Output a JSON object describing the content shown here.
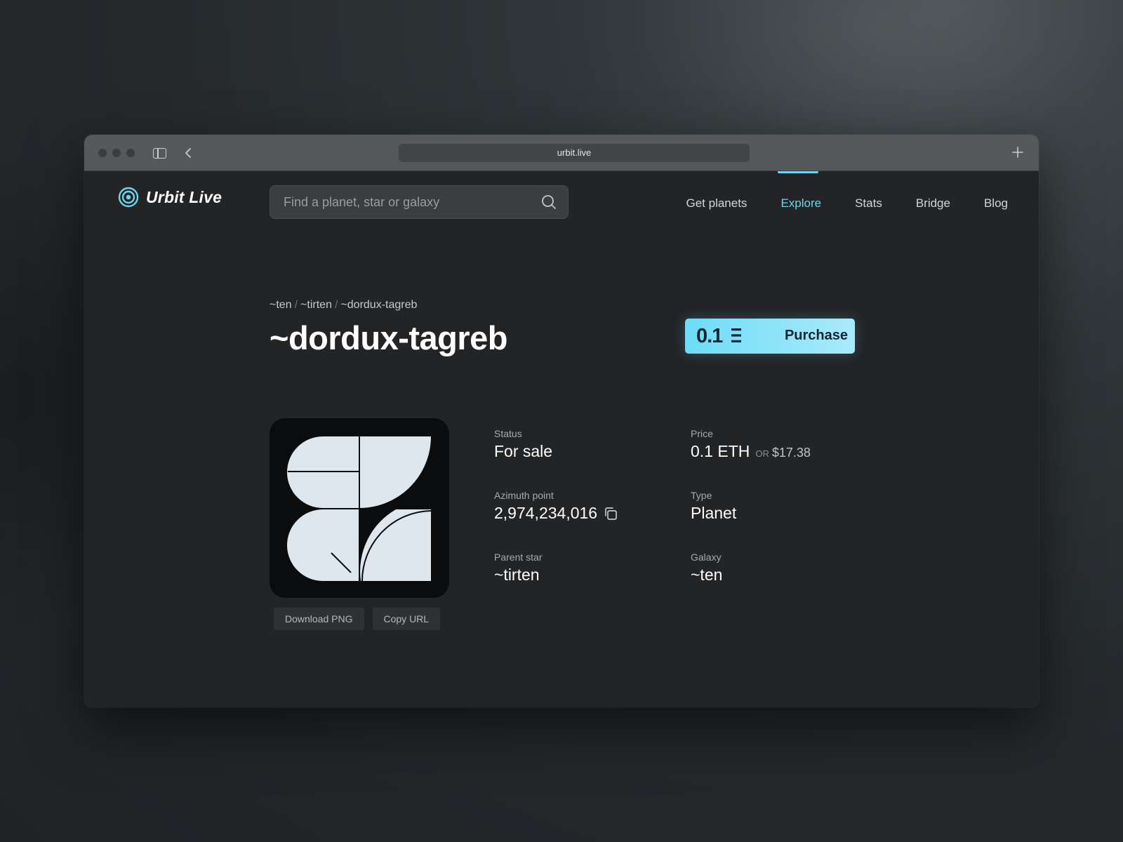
{
  "browser": {
    "url": "urbit.live"
  },
  "app": {
    "name": "Urbit Live"
  },
  "search": {
    "placeholder": "Find a planet, star or galaxy"
  },
  "menu": {
    "items": [
      {
        "label": "Get planets",
        "active": false
      },
      {
        "label": "Explore",
        "active": true
      },
      {
        "label": "Stats",
        "active": false
      },
      {
        "label": "Bridge",
        "active": false
      },
      {
        "label": "Blog",
        "active": false
      }
    ]
  },
  "breadcrumb": {
    "items": [
      "~ten",
      "~tirten",
      "~dordux-tagreb"
    ],
    "separator": "/"
  },
  "planet": {
    "name": "~dordux-tagreb"
  },
  "purchase": {
    "price": "0.1",
    "currency_icon": "ethereum-icon",
    "label": "Purchase"
  },
  "sigil_actions": {
    "download": "Download PNG",
    "copy": "Copy URL"
  },
  "details": {
    "status_label": "Status",
    "status_value": "For sale",
    "price_label": "Price",
    "price_eth": "0.1 ETH",
    "price_or": "or",
    "price_usd": "$17.38",
    "azimuth_label": "Azimuth point",
    "azimuth_value": "2,974,234,016",
    "type_label": "Type",
    "type_value": "Planet",
    "parent_label": "Parent star",
    "parent_value": "~tirten",
    "galaxy_label": "Galaxy",
    "galaxy_value": "~ten"
  },
  "colors": {
    "accent": "#6fd3ee",
    "background": "#222426",
    "sigil_fg": "#dde7ed",
    "sigil_bg": "#0b0c0d"
  }
}
